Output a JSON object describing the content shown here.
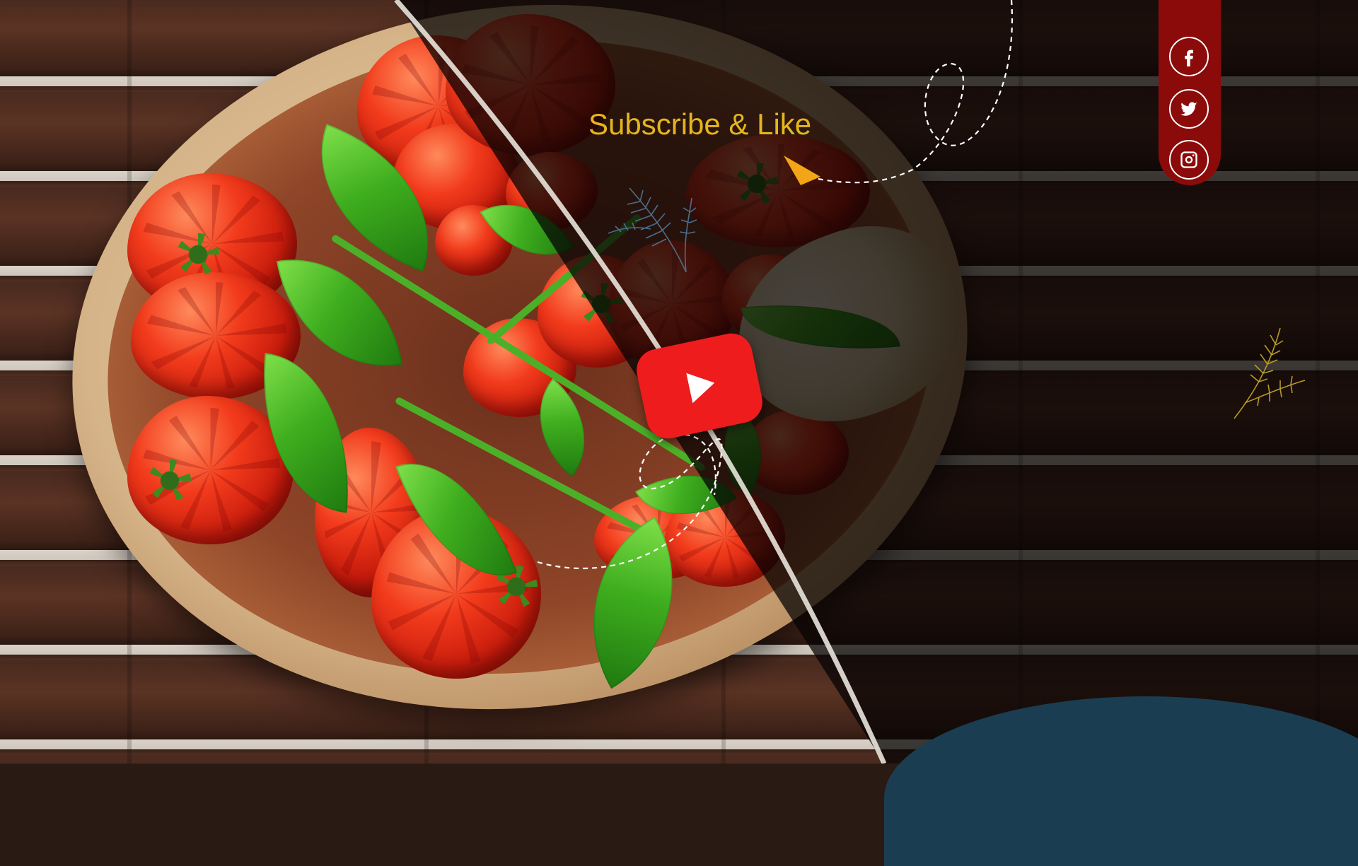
{
  "title_text": "Subscribe & Like",
  "social": [
    {
      "name": "facebook",
      "icon": "facebook-icon"
    },
    {
      "name": "twitter",
      "icon": "twitter-icon"
    },
    {
      "name": "instagram",
      "icon": "instagram-icon"
    }
  ],
  "play_button": {
    "icon": "youtube-play-icon"
  },
  "colors": {
    "accent_text": "#e5b51e",
    "social_bar": "#8b0b0b",
    "youtube_red": "#ee1c1c",
    "blob_blue": "#1a3d52",
    "arrow": "#f2a516"
  }
}
